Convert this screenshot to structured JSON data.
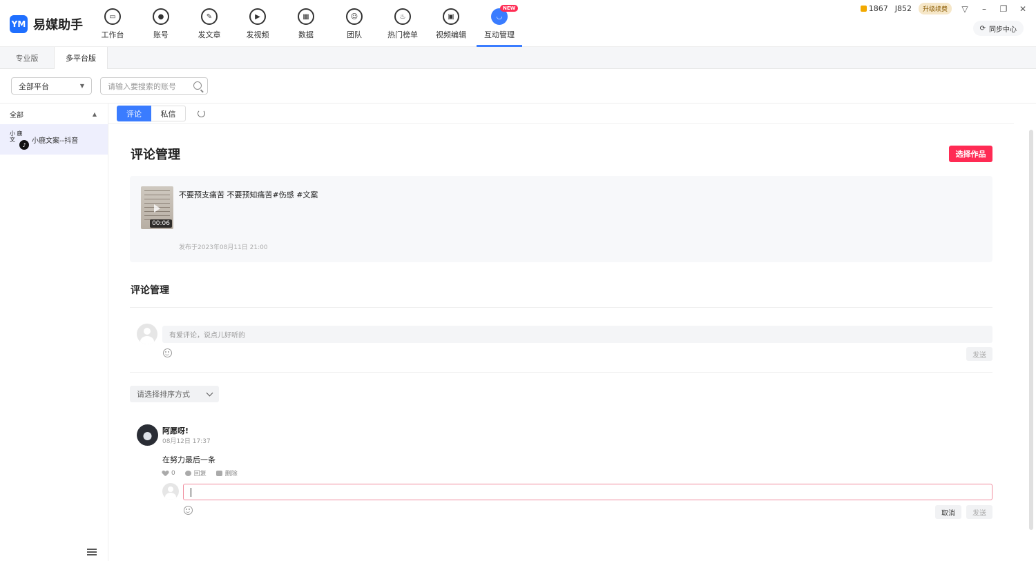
{
  "app": {
    "logo_mark": "YM",
    "name": "易媒助手"
  },
  "nav": [
    {
      "label": "工作台",
      "icon": "monitor-icon"
    },
    {
      "label": "账号",
      "icon": "user-icon"
    },
    {
      "label": "发文章",
      "icon": "pen-icon"
    },
    {
      "label": "发视频",
      "icon": "play-icon"
    },
    {
      "label": "数据",
      "icon": "chart-icon"
    },
    {
      "label": "团队",
      "icon": "team-icon"
    },
    {
      "label": "热门榜单",
      "icon": "fire-icon"
    },
    {
      "label": "视频编辑",
      "icon": "briefcase-icon"
    },
    {
      "label": "互动管理",
      "icon": "chat-icon",
      "badge": "NEW",
      "active": true
    }
  ],
  "topright": {
    "coins": "1867",
    "points": "J852",
    "upgrade": "升级续费",
    "sync": "同步中心"
  },
  "tabs": [
    {
      "label": "专业版"
    },
    {
      "label": "多平台版",
      "active": true
    }
  ],
  "filter": {
    "platform": "全部平台",
    "search_placeholder": "请输入要搜索的账号"
  },
  "sidebar": {
    "header": "全部",
    "account": {
      "avatar_text": "小 鹿 文",
      "name": "小鹿文案--抖音",
      "platform_icon": "tiktok-icon"
    }
  },
  "content_tabs": [
    {
      "label": "评论",
      "active": true
    },
    {
      "label": "私信"
    }
  ],
  "page": {
    "title": "评论管理",
    "select_work": "选择作品",
    "work": {
      "duration": "00:06",
      "title": "不要预支痛苦 不要预知痛苦#伤感 #文案",
      "published": "发布于2023年08月11日 21:00"
    },
    "section_title": "评论管理",
    "comment_placeholder": "有爱评论，说点儿好听的",
    "send": "发送",
    "sort_placeholder": "请选择排序方式",
    "comment": {
      "user": "阿愿呀!",
      "time": "08月12日 17:37",
      "text": "在努力最后一条",
      "likes": "0",
      "reply": "回复",
      "delete": "删除"
    },
    "cancel": "取消"
  }
}
